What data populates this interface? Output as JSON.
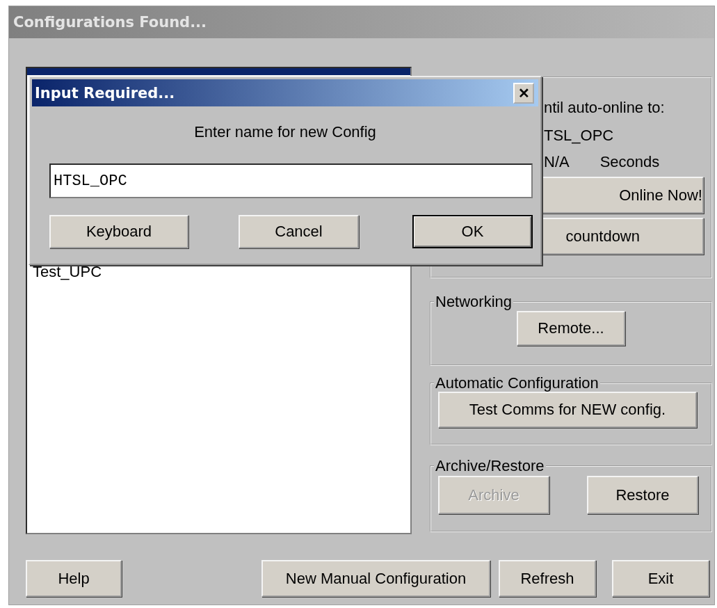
{
  "window": {
    "title": "Configurations Found..."
  },
  "config_list": {
    "items": [
      {
        "text": "Test_UPC",
        "selected": false
      }
    ]
  },
  "auto_online": {
    "countdown_text": "ntil auto-online to:",
    "config_name": "TSL_OPC",
    "seconds_value": "N/A",
    "seconds_unit": "Seconds",
    "buttons": [
      {
        "label": "Online Now!",
        "disabled": false
      },
      {
        "label": "countdown",
        "disabled": false
      }
    ]
  },
  "networking": {
    "title": "Networking",
    "buttons": [
      {
        "label": "Remote...",
        "disabled": false
      }
    ]
  },
  "automatic_configuration": {
    "title": "Automatic Configuration",
    "buttons": [
      {
        "label": "Test Comms for NEW config.",
        "disabled": false
      }
    ]
  },
  "archive_restore": {
    "title": "Archive/Restore",
    "buttons": [
      {
        "label": "Archive",
        "disabled": true
      },
      {
        "label": "Restore",
        "disabled": false
      }
    ]
  },
  "bottom_buttons": [
    {
      "label": "Help",
      "disabled": false
    },
    {
      "label": "New Manual Configuration",
      "disabled": false
    },
    {
      "label": "Refresh",
      "disabled": false
    },
    {
      "label": "Exit",
      "disabled": false
    }
  ],
  "dialog": {
    "title": "Input Required...",
    "close": "✕",
    "prompt": "Enter name for new Config",
    "value": "HTSL_OPC",
    "buttons": [
      {
        "label": "Keyboard",
        "default": false
      },
      {
        "label": "Cancel",
        "default": false
      },
      {
        "label": "OK",
        "default": true
      }
    ]
  }
}
